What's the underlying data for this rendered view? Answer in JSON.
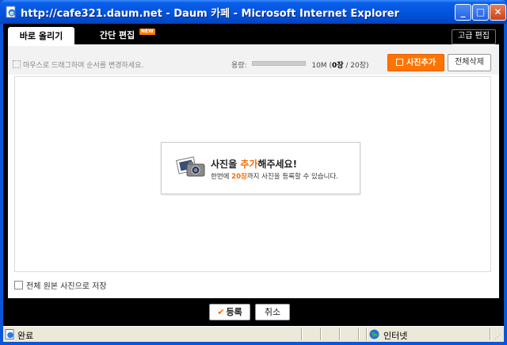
{
  "window": {
    "title": "http://cafe321.daum.net - Daum 카페 - Microsoft Internet Explorer",
    "min_glyph": "_",
    "max_glyph": "□",
    "close_glyph": "✕"
  },
  "tabs": {
    "active_label": "바로 올리기",
    "other_label": "간단 편집",
    "badge": "NEW",
    "advanced_label": "고급 편집"
  },
  "toolbar": {
    "drag_hint": "마우스로 드래그하여 순서를 변경하세요.",
    "capacity_label": "용량:",
    "capacity_value": "10M",
    "capacity_fraction": 0,
    "count_open": "(",
    "count_current": "0장",
    "count_total": " / 20장)",
    "add_photo_label": "사진추가",
    "delete_all_label": "전체삭제"
  },
  "prompt": {
    "title_pre": "사진을 ",
    "title_hl": "추가",
    "title_post": "해주세요!",
    "sub_pre": "한번에 ",
    "sub_hl": "20장",
    "sub_post": "까지 사진을 등록할 수 있습니다."
  },
  "options": {
    "save_original_label": "전체 원본 사진으로 저장"
  },
  "footer": {
    "register_label": "등록",
    "cancel_label": "취소"
  },
  "statusbar": {
    "status": "완료",
    "zone": "인터넷"
  },
  "colors": {
    "accent": "#ff7400",
    "titlebar": "#0355e0"
  }
}
